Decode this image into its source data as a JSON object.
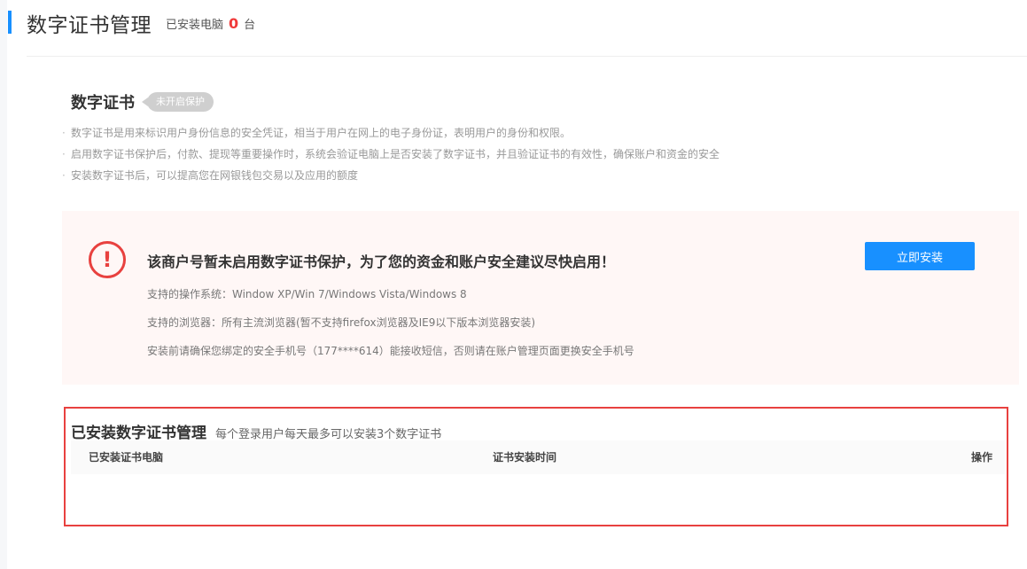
{
  "header": {
    "title": "数字证书管理",
    "installed_label": "已安装电脑",
    "installed_count": "0",
    "installed_unit": "台"
  },
  "cert_section": {
    "title": "数字证书",
    "status_badge": "未开启保护",
    "descriptions": [
      "数字证书是用来标识用户身份信息的安全凭证，相当于用户在网上的电子身份证，表明用户的身份和权限。",
      "启用数字证书保护后，付款、提现等重要操作时，系统会验证电脑上是否安装了数字证书，并且验证证书的有效性，确保账户和资金的安全",
      "安装数字证书后，可以提高您在网银钱包交易以及应用的额度"
    ]
  },
  "alert": {
    "icon": "exclamation-circle-icon",
    "title": "该商户号暂未启用数字证书保护，为了您的资金和账户安全建议尽快启用！",
    "os_support": "支持的操作系统：Window XP/Win 7/Windows Vista/Windows 8",
    "browser_support": "支持的浏览器：所有主流浏览器(暂不支持firefox浏览器及IE9以下版本浏览器安装)",
    "phone_notice": "安装前请确保您绑定的安全手机号（177****614）能接收短信，否则请在账户管理页面更换安全手机号",
    "install_button": "立即安装"
  },
  "installed": {
    "title": "已安装数字证书管理",
    "subtitle": "每个登录用户每天最多可以安装3个数字证书",
    "columns": [
      "已安装证书电脑",
      "证书安装时间",
      "操作"
    ]
  },
  "colors": {
    "accent": "#1890ff",
    "danger": "#e8413f",
    "count": "#f03a3a"
  }
}
